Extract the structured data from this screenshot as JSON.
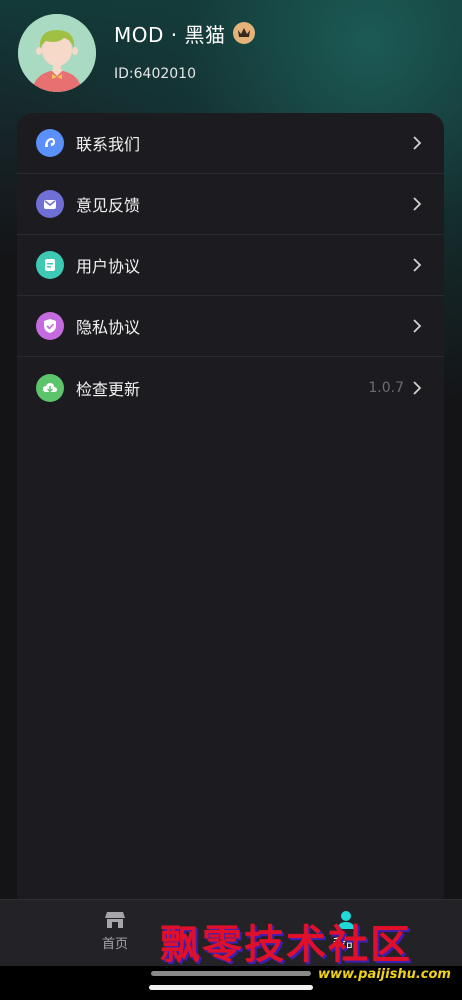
{
  "profile": {
    "name": "MOD · 黑猫",
    "id_text": "ID:6402010",
    "avatar_icon": "avatar-girl",
    "badge_icon": "crown-icon"
  },
  "menu": [
    {
      "label": "联系我们",
      "icon": "contact-icon",
      "color": "#5b8ff9"
    },
    {
      "label": "意见反馈",
      "icon": "mail-icon",
      "color": "#6f6fd6"
    },
    {
      "label": "用户协议",
      "icon": "document-icon",
      "color": "#3dc9b4"
    },
    {
      "label": "隐私协议",
      "icon": "shield-icon",
      "color": "#c56be0"
    },
    {
      "label": "检查更新",
      "icon": "cloud-download-icon",
      "color": "#5cc46a",
      "value": "1.0.7"
    }
  ],
  "tabs": [
    {
      "label": "首页",
      "icon": "store-icon"
    },
    {
      "label": "我的",
      "icon": "user-icon",
      "active_color": "#21d8d8"
    }
  ],
  "watermark": {
    "text": "飘零技术社区",
    "url": "www.paijishu.com"
  }
}
